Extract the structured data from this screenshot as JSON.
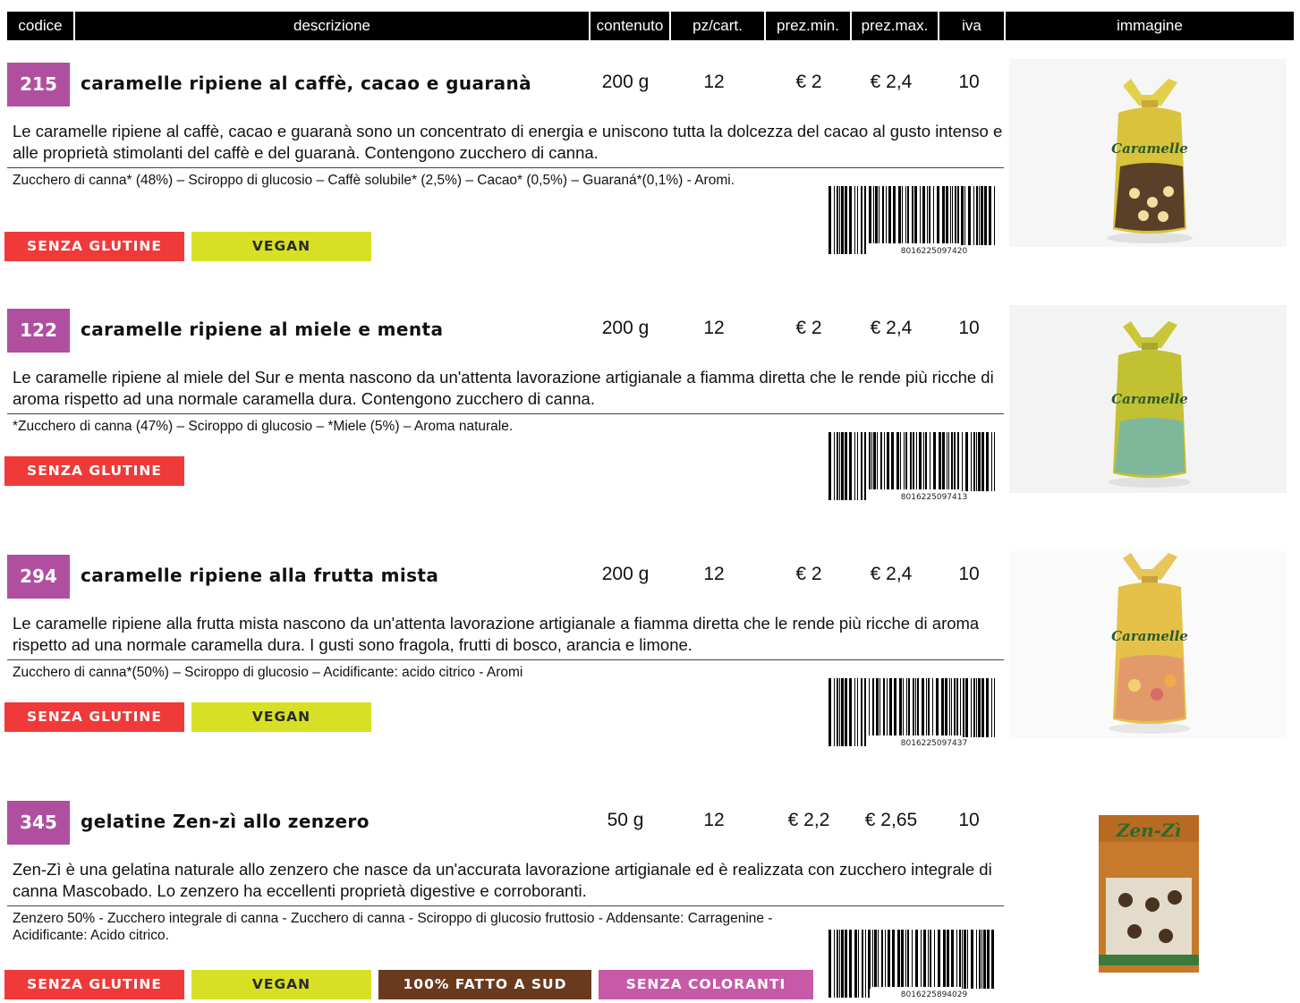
{
  "header": {
    "codice": "codice",
    "descrizione": "descrizione",
    "contenuto": "contenuto",
    "pz_cart": "pz/cart.",
    "prez_min": "prez.min.",
    "prez_max": "prez.max.",
    "iva": "iva",
    "immagine": "immagine"
  },
  "colors": {
    "code_bg": "#b04fa0",
    "senza_glutine": "#ef3a39",
    "vegan": "#d7e025",
    "fatto_a_sud": "#6a3a1f",
    "senza_coloranti": "#c75aa6"
  },
  "products": [
    {
      "code": "215",
      "title": "caramelle ripiene al caffè, cacao e guaranà",
      "contenuto": "200 g",
      "pz": "12",
      "prez_min": "€ 2",
      "prez_max": "€ 2,4",
      "iva": "10",
      "description": "Le caramelle ripiene al caffè, cacao e guaranà sono un concentrato di energia e uniscono tutta la dolcezza del cacao al gusto intenso e alle proprietà stimolanti del caffè e del guaranà. Contengono zucchero di canna.",
      "ingredients": "Zucchero di canna* (48%) – Sciroppo di glucosio – Caffè solubile* (2,5%) – Cacao* (0,5%) – Guaraná*(0,1%) - Aromi.",
      "badges": [
        "SENZA GLUTINE",
        "VEGAN"
      ],
      "barcode": "8016225097420",
      "packaging_text": "Caramelle"
    },
    {
      "code": "122",
      "title": "caramelle ripiene al miele e menta",
      "contenuto": "200 g",
      "pz": "12",
      "prez_min": "€ 2",
      "prez_max": "€ 2,4",
      "iva": "10",
      "description": "Le caramelle ripiene al miele del Sur e menta nascono da un'attenta lavorazione artigianale a fiamma diretta che le rende più ricche di aroma rispetto ad una normale caramella dura. Contengono zucchero di canna.",
      "ingredients": "*Zucchero di canna (47%) – Sciroppo di glucosio – *Miele (5%) – Aroma naturale.",
      "badges": [
        "SENZA GLUTINE"
      ],
      "barcode": "8016225097413",
      "packaging_text": "Caramelle"
    },
    {
      "code": "294",
      "title": "caramelle ripiene alla frutta mista",
      "contenuto": "200 g",
      "pz": "12",
      "prez_min": "€ 2",
      "prez_max": "€ 2,4",
      "iva": "10",
      "description": "Le caramelle ripiene alla frutta mista nascono da un'attenta lavorazione artigianale a fiamma diretta che le rende più ricche di aroma rispetto ad una normale caramella dura. I gusti sono fragola, frutti di bosco, arancia e limone.",
      "ingredients": "Zucchero di canna*(50%) – Sciroppo di glucosio – Acidificante: acido citrico - Aromi",
      "badges": [
        "SENZA GLUTINE",
        "VEGAN"
      ],
      "barcode": "8016225097437",
      "packaging_text": "Caramelle"
    },
    {
      "code": "345",
      "title": "gelatine Zen-zì allo zenzero",
      "contenuto": "50 g",
      "pz": "12",
      "prez_min": "€ 2,2",
      "prez_max": "€ 2,65",
      "iva": "10",
      "description": "Zen-Zì è una gelatina naturale allo zenzero che nasce da un'accurata lavorazione artigianale ed è realizzata con zucchero integrale di canna Mascobado. Lo zenzero ha eccellenti proprietà digestive e corroboranti.",
      "ingredients": "Zenzero 50% - Zucchero integrale di canna - Zucchero di canna - Sciroppo di glucosio fruttosio - Addensante: Carragenine - Acidificante: Acido citrico.",
      "badges": [
        "SENZA GLUTINE",
        "VEGAN",
        "100% FATTO A SUD",
        "SENZA COLORANTI"
      ],
      "barcode": "8016225894029",
      "packaging_text": "Zen-Zì"
    }
  ]
}
